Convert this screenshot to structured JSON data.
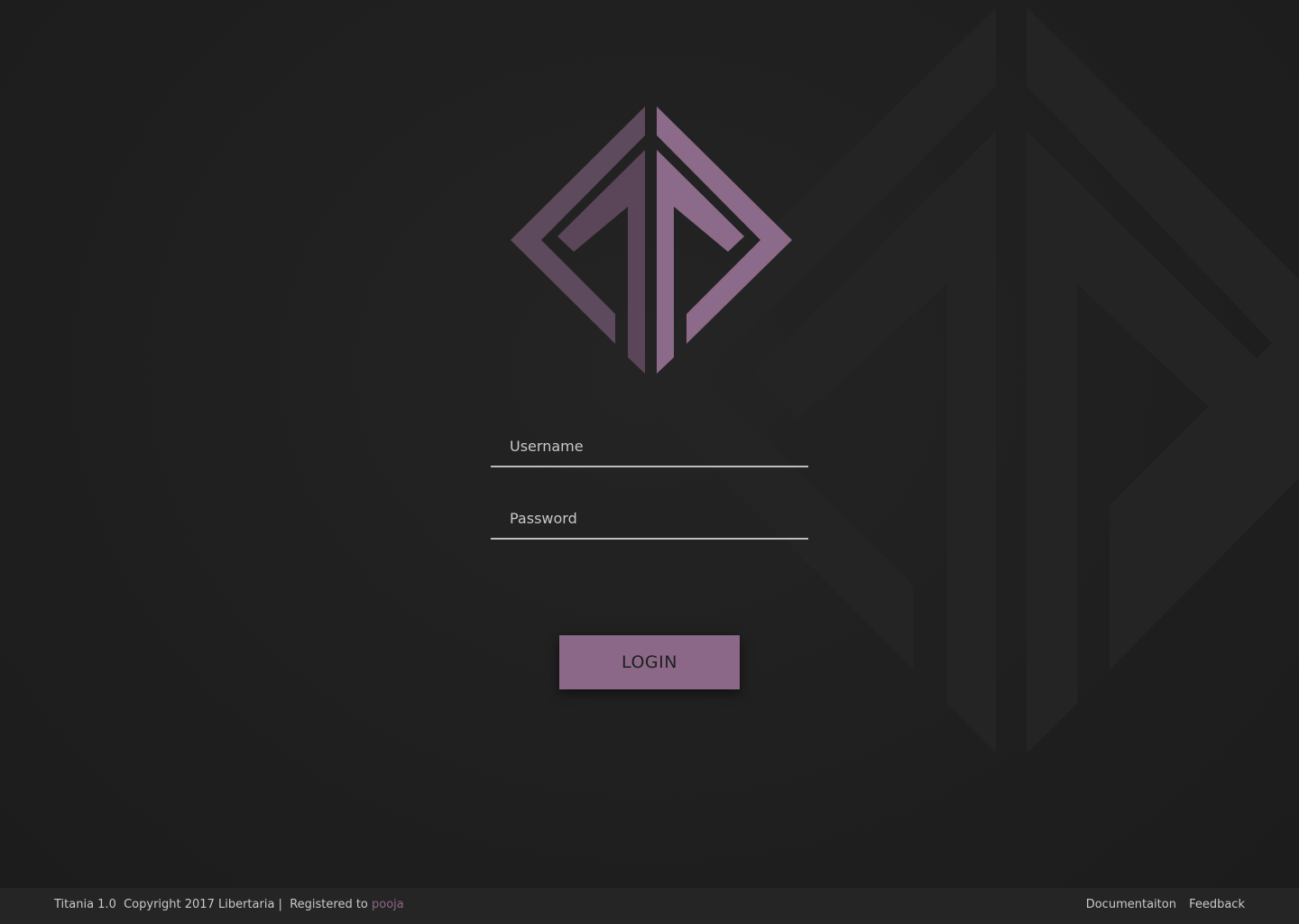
{
  "app": {
    "logo_icon": "titania-diamond-logo-icon",
    "accent_color": "#8b6887"
  },
  "login_form": {
    "username_placeholder": "Username",
    "username_value": "",
    "password_placeholder": "Password",
    "password_value": "",
    "login_label": "LOGIN"
  },
  "footer": {
    "product": "Titania 1.0",
    "copyright": "Copyright 2017 Libertaria |",
    "registered_to_label": "Registered to",
    "registered_user": "pooja",
    "links": [
      "Documentaiton",
      "Feedback"
    ]
  }
}
